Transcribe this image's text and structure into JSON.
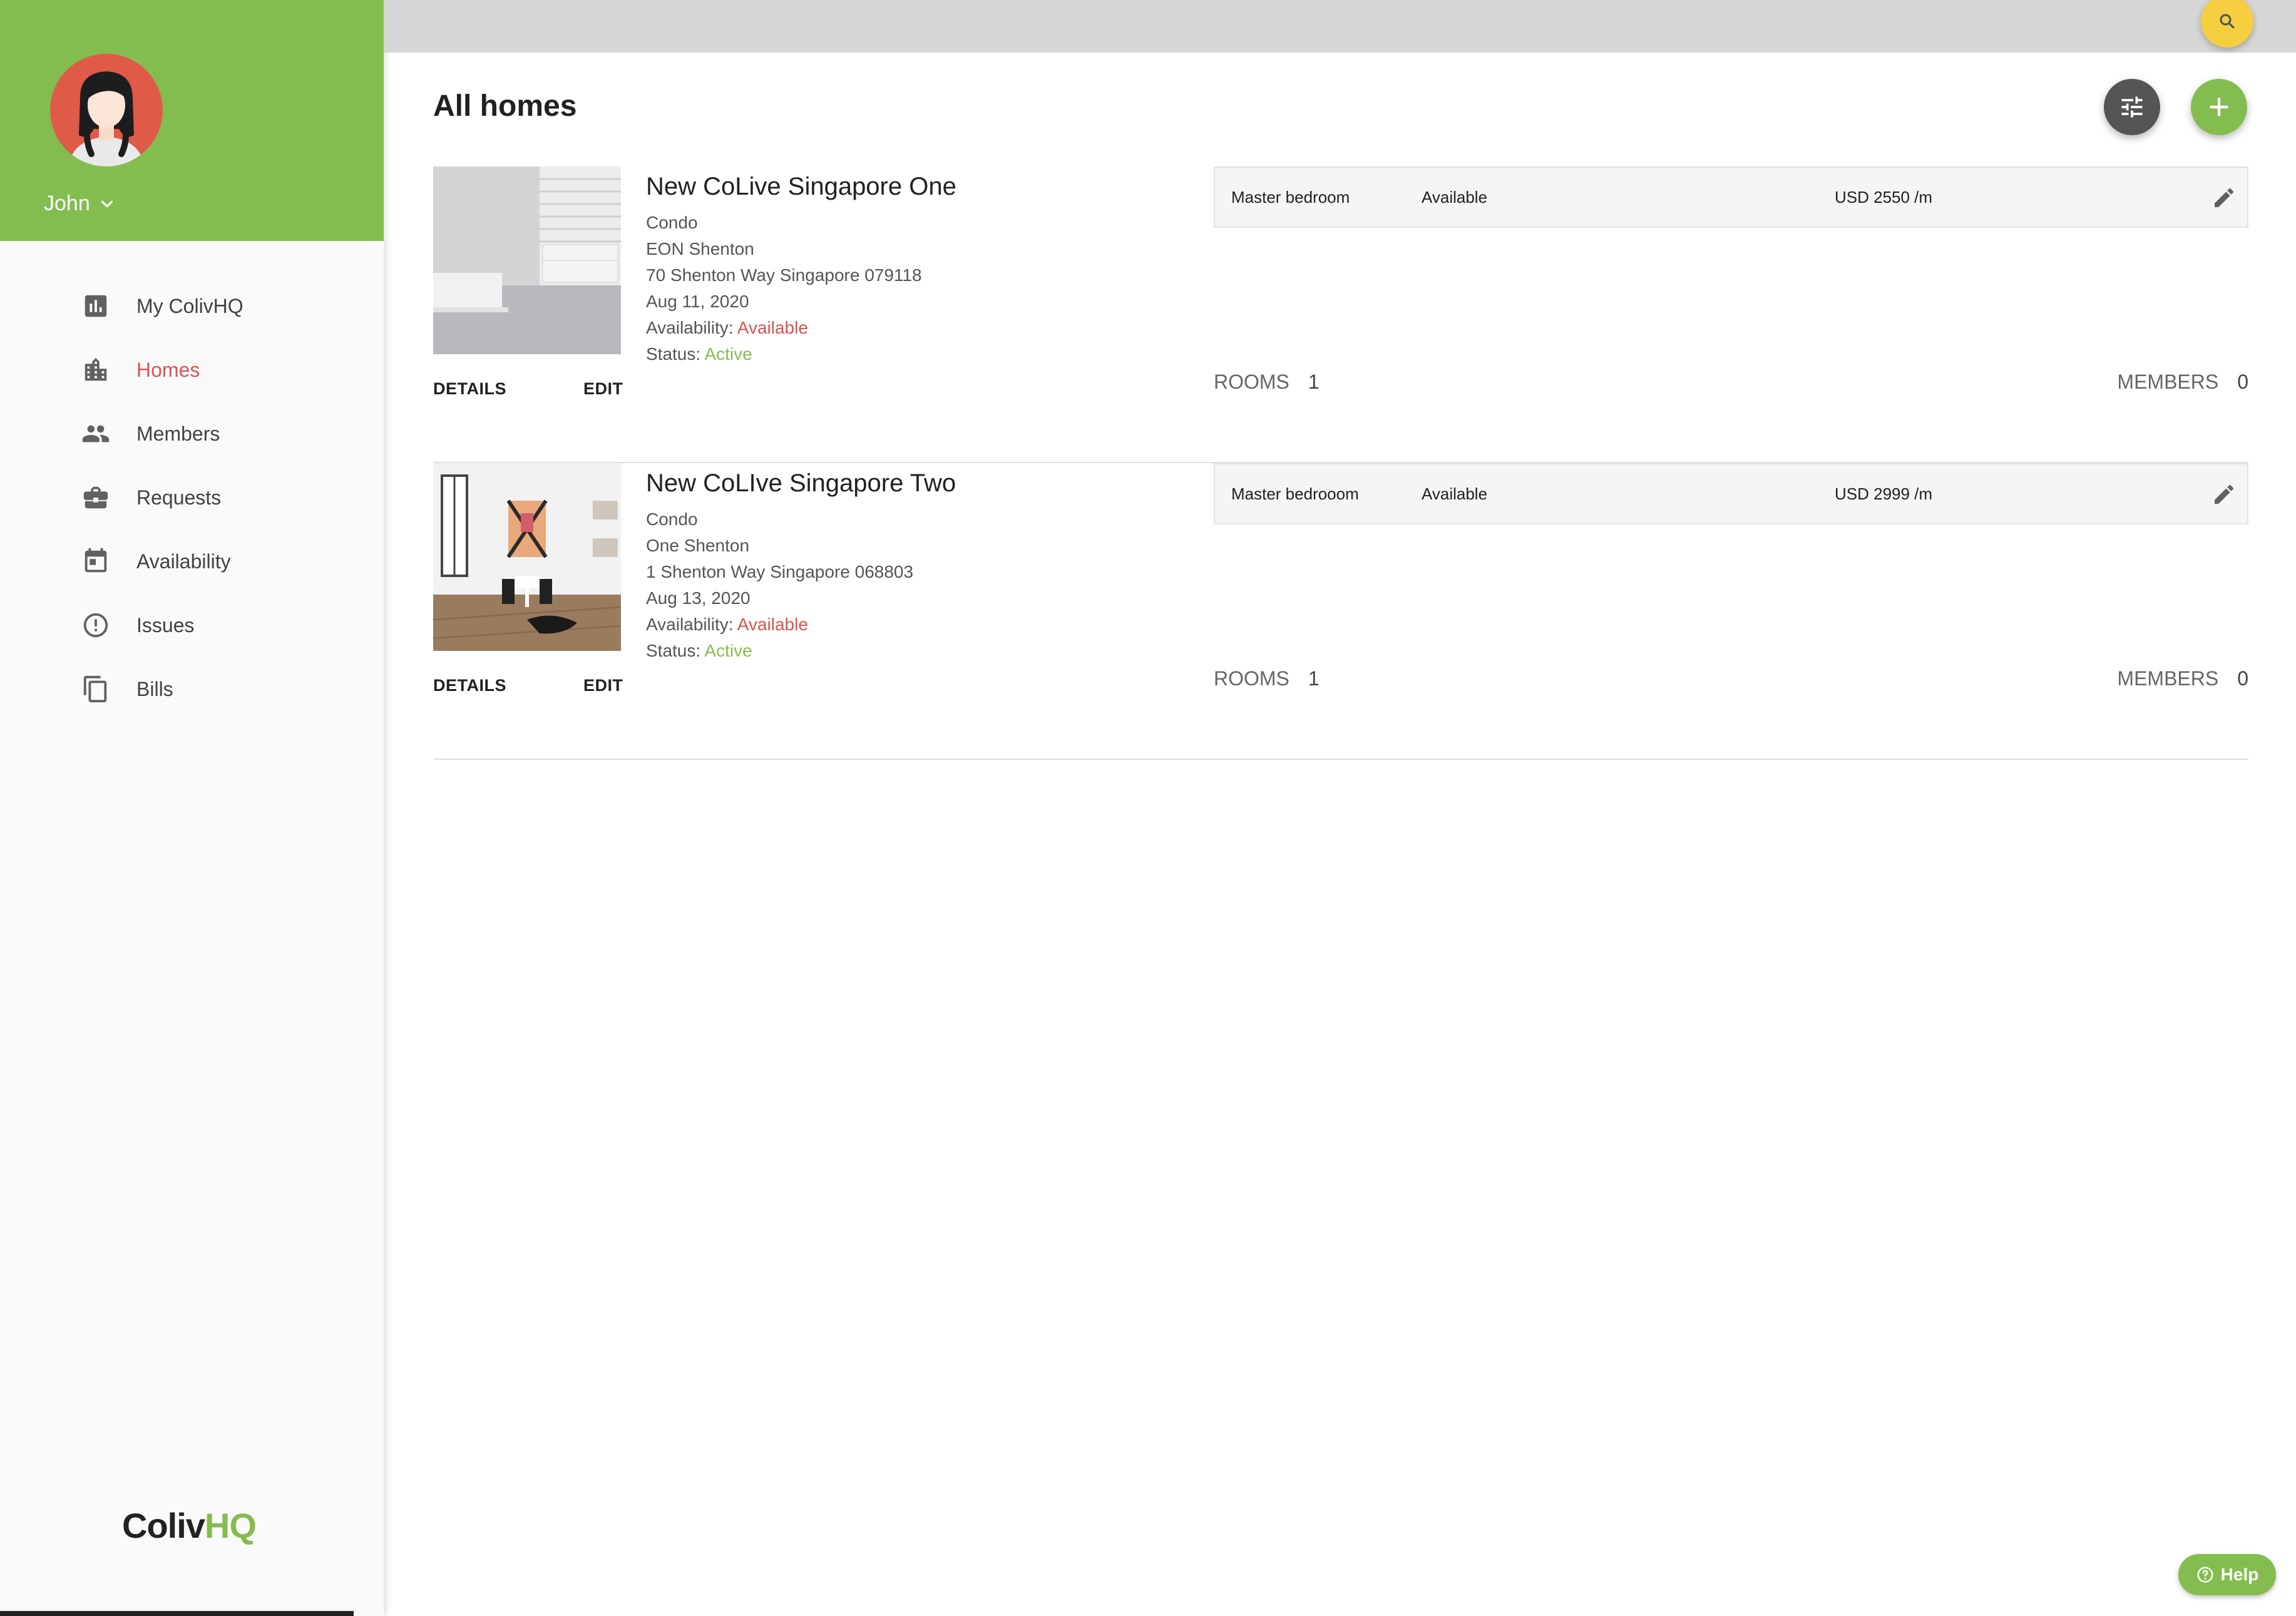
{
  "user": {
    "name": "John"
  },
  "nav": [
    {
      "label": "My ColivHQ",
      "icon": "bar-chart-icon",
      "active": false
    },
    {
      "label": "Homes",
      "icon": "building-icon",
      "active": true
    },
    {
      "label": "Members",
      "icon": "people-icon",
      "active": false
    },
    {
      "label": "Requests",
      "icon": "briefcase-icon",
      "active": false
    },
    {
      "label": "Availability",
      "icon": "calendar-icon",
      "active": false
    },
    {
      "label": "Issues",
      "icon": "alert-circle-icon",
      "active": false
    },
    {
      "label": "Bills",
      "icon": "copy-icon",
      "active": false
    }
  ],
  "logo": {
    "part1": "Coliv",
    "part2": "HQ"
  },
  "page": {
    "title": "All homes"
  },
  "homes": [
    {
      "name": "New CoLive Singapore One",
      "type": "Condo",
      "building": "EON Shenton",
      "address": "70 Shenton Way Singapore 079118",
      "date": "Aug 11, 2020",
      "availability_label": "Availability:",
      "availability": "Available",
      "status_label": "Status:",
      "status": "Active",
      "details_label": "DETAILS",
      "edit_label": "EDIT",
      "room": {
        "name": "Master bedroom",
        "availability": "Available",
        "price": "USD 2550 /m"
      },
      "rooms_label": "ROOMS",
      "rooms_count": "1",
      "members_label": "MEMBERS",
      "members_count": "0"
    },
    {
      "name": "New CoLIve Singapore Two",
      "type": "Condo",
      "building": "One Shenton",
      "address": "1 Shenton Way Singapore 068803",
      "date": "Aug 13, 2020",
      "availability_label": "Availability:",
      "availability": "Available",
      "status_label": "Status:",
      "status": "Active",
      "details_label": "DETAILS",
      "edit_label": "EDIT",
      "room": {
        "name": "Master bedrooom",
        "availability": "Available",
        "price": "USD 2999 /m"
      },
      "rooms_label": "ROOMS",
      "rooms_count": "1",
      "members_label": "MEMBERS",
      "members_count": "0"
    }
  ],
  "help": {
    "label": "Help"
  },
  "colors": {
    "brand_green": "#84bd4f",
    "accent_red": "#d9534f",
    "search_yellow": "#f5cf3f",
    "avatar_red": "#e05a48"
  }
}
